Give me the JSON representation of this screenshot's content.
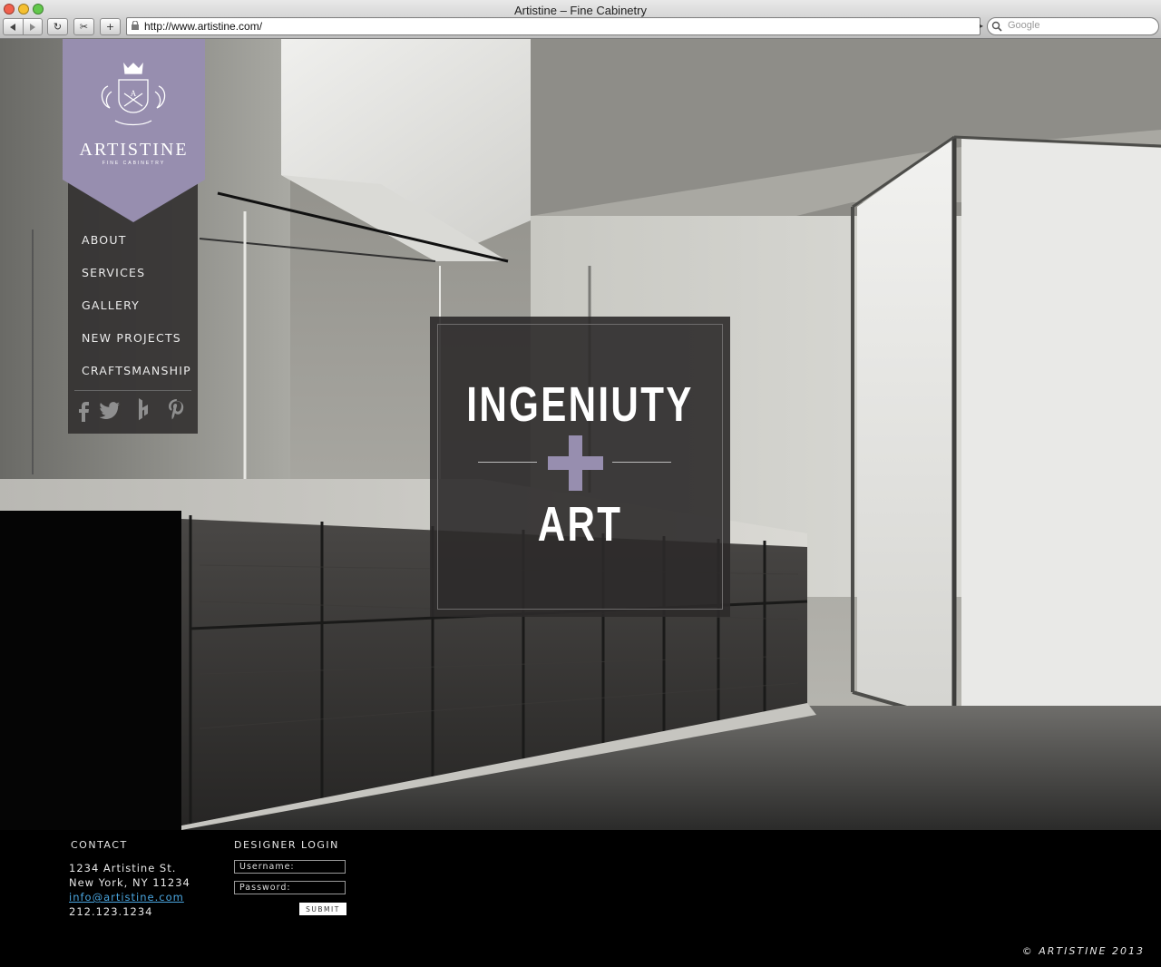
{
  "window": {
    "title": "Artistine – Fine Cabinetry",
    "url": "http://www.artistine.com/",
    "search_placeholder": "Google"
  },
  "brand": {
    "name": "ARTISTINE",
    "tagline": "FINE CABINETRY",
    "accent_color": "#978eaf"
  },
  "nav": {
    "items": [
      {
        "label": "ABOUT"
      },
      {
        "label": "SERVICES"
      },
      {
        "label": "GALLERY"
      },
      {
        "label": "NEW PROJECTS"
      },
      {
        "label": "CRAFTSMANSHIP"
      }
    ],
    "social": [
      "facebook-icon",
      "twitter-icon",
      "houzz-icon",
      "pinterest-icon"
    ]
  },
  "hero": {
    "line1": "INGENIUTY",
    "line2": "ART"
  },
  "footer": {
    "contact": {
      "heading": "CONTACT",
      "address1": "1234 Artistine St.",
      "address2": "New York, NY 11234",
      "email": "info@artistine.com",
      "phone": "212.123.1234"
    },
    "login": {
      "heading": "DESIGNER LOGIN",
      "username_placeholder": "Username:",
      "password_placeholder": "Password:",
      "submit_label": "SUBMIT"
    },
    "copyright": "© ARTISTINE 2013"
  }
}
